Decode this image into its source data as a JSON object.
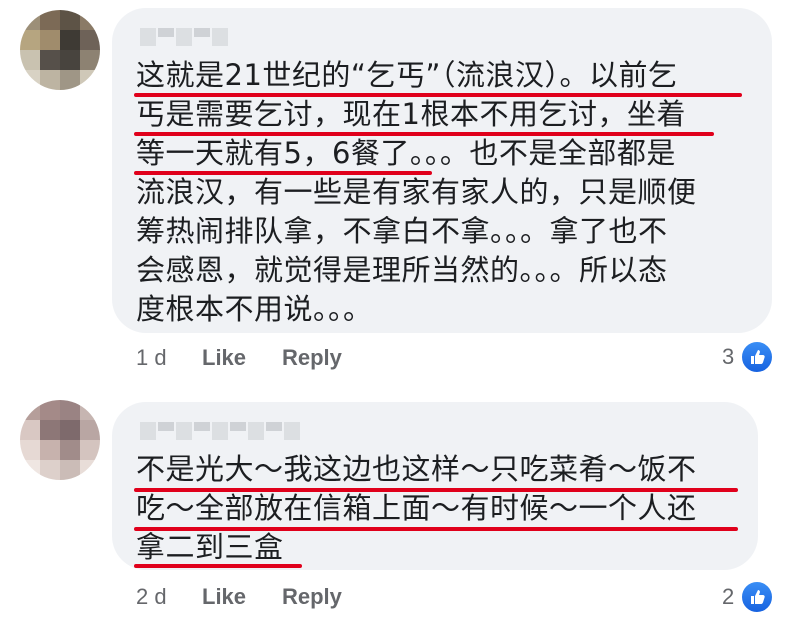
{
  "comments": [
    {
      "lines": [
        "这就是21世纪的“乞丐”（流浪汉）。以前乞",
        "丐是需要乞讨，现在1根本不用乞讨，坐着",
        "等一天就有5，6餐了。。。也不是全部都是",
        "流浪汉，有一些是有家有家人的，只是顺便",
        "筹热闹排队拿，不拿白不拿。。。拿了也不",
        "会感恩，就觉得是理所当然的。。。所以态",
        "度根本不用说。。。"
      ],
      "time": "1 d",
      "like_label": "Like",
      "reply_label": "Reply",
      "reaction_count": "3"
    },
    {
      "lines": [
        "不是光大～我这边也这样～只吃菜肴～饭不",
        "吃～全部放在信箱上面～有时候～一个人还",
        "拿二到三盒"
      ],
      "time": "2 d",
      "like_label": "Like",
      "reply_label": "Reply",
      "reaction_count": "2"
    }
  ],
  "colors": {
    "bubble": "#f0f2f5",
    "underline": "#e0001b",
    "meta_text": "#65676b",
    "like_blue": "#1877f2"
  },
  "icons": {
    "reaction": "thumbs-up-icon",
    "avatar": "pixelated-avatar"
  }
}
